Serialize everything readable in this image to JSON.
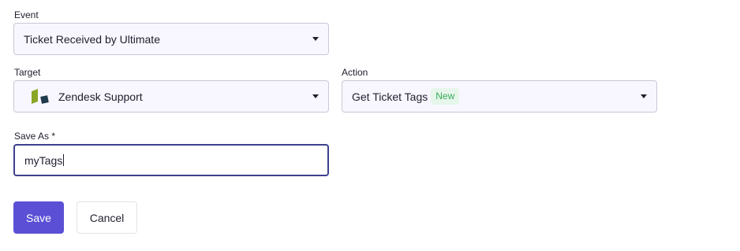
{
  "event": {
    "label": "Event",
    "value": "Ticket Received by Ultimate"
  },
  "target": {
    "label": "Target",
    "value": "Zendesk Support",
    "icon": "zendesk-logo-icon"
  },
  "action": {
    "label": "Action",
    "value": "Get Ticket Tags",
    "badge": "New"
  },
  "save_as": {
    "label": "Save As *",
    "value": "myTags"
  },
  "buttons": {
    "save_label": "Save",
    "cancel_label": "Cancel"
  },
  "colors": {
    "primary": "#5b4fd6",
    "focus_border": "#3d3f8f",
    "select_bg": "#f8f7ff",
    "badge_bg": "#e6f6ea",
    "badge_text": "#3aa85c",
    "zendesk_green": "#8aa624",
    "zendesk_dark": "#1f3b4d"
  }
}
